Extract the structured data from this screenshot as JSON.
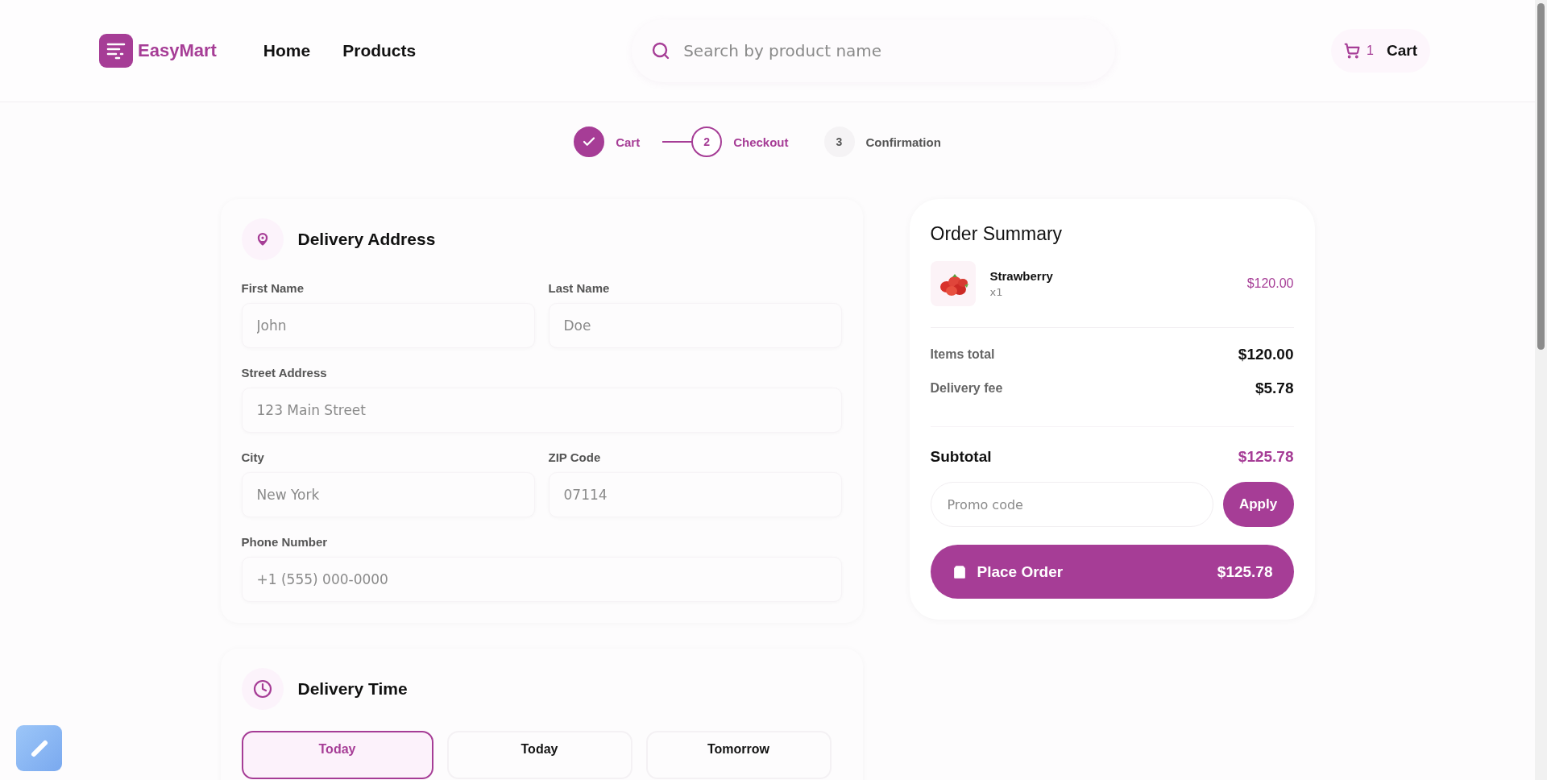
{
  "header": {
    "brand": "EasyMart",
    "nav": [
      {
        "label": "Home"
      },
      {
        "label": "Products"
      }
    ],
    "search": {
      "placeholder": "Search by product name"
    },
    "cart": {
      "count": "1",
      "label": "Cart"
    }
  },
  "steps": [
    {
      "label": "Cart",
      "kind": "done"
    },
    {
      "number": "2",
      "label": "Checkout",
      "kind": "current"
    },
    {
      "number": "3",
      "label": "Confirmation",
      "kind": "upcoming"
    }
  ],
  "address": {
    "title": "Delivery Address",
    "fields": [
      {
        "label": "First Name",
        "placeholder": "John",
        "kind": "half"
      },
      {
        "label": "Last Name",
        "placeholder": "Doe",
        "kind": "half"
      },
      {
        "label": "Street Address",
        "placeholder": "123 Main Street",
        "kind": "full"
      },
      {
        "label": "City",
        "placeholder": "New York",
        "kind": "half"
      },
      {
        "label": "ZIP Code",
        "placeholder": "07114",
        "kind": "half"
      },
      {
        "label": "Phone Number",
        "placeholder": "+1 (555) 000-0000",
        "kind": "full"
      }
    ]
  },
  "delivery_time": {
    "title": "Delivery Time",
    "slots": [
      {
        "label": "Today",
        "selected": true
      },
      {
        "label": "Today",
        "selected": false
      },
      {
        "label": "Tomorrow",
        "selected": false
      }
    ]
  },
  "summary": {
    "title": "Order Summary",
    "items": [
      {
        "kind": "picture",
        "name": "Strawberry",
        "qty": "x1",
        "price": "$120.00"
      }
    ],
    "lines": [
      {
        "label": "Items total",
        "value": "$120.00"
      },
      {
        "label": "Delivery fee",
        "value": "$5.78"
      }
    ],
    "subtotal": {
      "label": "Subtotal",
      "value": "$125.78"
    },
    "promo": {
      "placeholder": "Promo code",
      "button": "Apply"
    },
    "place_order": {
      "label": "Place Order",
      "amount": "$125.78"
    }
  }
}
